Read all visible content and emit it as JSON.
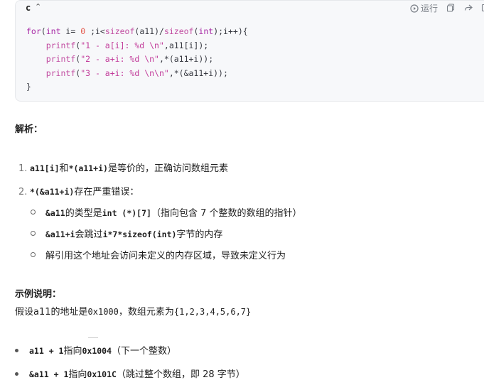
{
  "code_block": {
    "language": "c",
    "run_label": "运行",
    "lines": [
      "for(int i= 0 ;i<sizeof(a11)/sizeof(int);i++){",
      "    printf(\"1 - a[i]: %d \\n\",a11[i]);",
      "    printf(\"2 - a+i: %d \\n\",*(a11+i));",
      "    printf(\"3 - a+i: %d \\n\\n\",*(&a11+i));",
      "}"
    ]
  },
  "analysis": {
    "heading": "解析：",
    "items": [
      {
        "num": "1.",
        "code1": "a11[i]",
        "text1": "和",
        "code2": "*(a11+i)",
        "text2": "是等价的，正确访问数组元素"
      },
      {
        "num": "2.",
        "code1": "*(&a11+i)",
        "text1": "存在严重错误："
      }
    ],
    "subitems": [
      {
        "code1": "&a11",
        "text1": "的类型是",
        "code2": "int (*)[7]",
        "text2": "（指向包含 7 个整数的数组的指针）"
      },
      {
        "code1": "&a11+i",
        "text1": "会跳过",
        "code2": "i*7*sizeof(int)",
        "text2": "字节的内存"
      },
      {
        "text1": "解引用这个地址会访问未定义的内存区域，导致未定义行为"
      }
    ]
  },
  "example": {
    "heading": "示例说明：",
    "intro_text1": "假设a11的地址是",
    "intro_code1": "0x1000",
    "intro_text2": "，数组元素为",
    "intro_code2": "{1,2,3,4,5,6,7}",
    "bullets": [
      {
        "code1": "a11 + 1",
        "text1": "指向",
        "code2": "0x1004",
        "text2": "（下一个整数）"
      },
      {
        "code1": "&a11 + 1",
        "text1": "指向",
        "code2": "0x101C",
        "text2": "（跳过整个数组，即 28 字节）"
      }
    ]
  }
}
